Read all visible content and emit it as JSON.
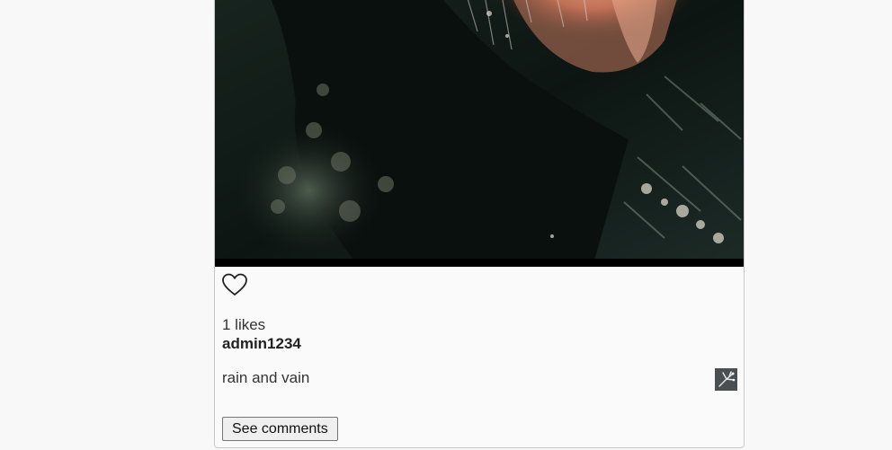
{
  "post": {
    "image_alt": "rain and vain",
    "like_icon": "heart-outline-icon",
    "likes_text": "1 likes",
    "author": "admin1234",
    "caption": "rain and vain",
    "avatar_icon": "user-avatar-thumbnail",
    "see_comments_label": "See comments"
  }
}
